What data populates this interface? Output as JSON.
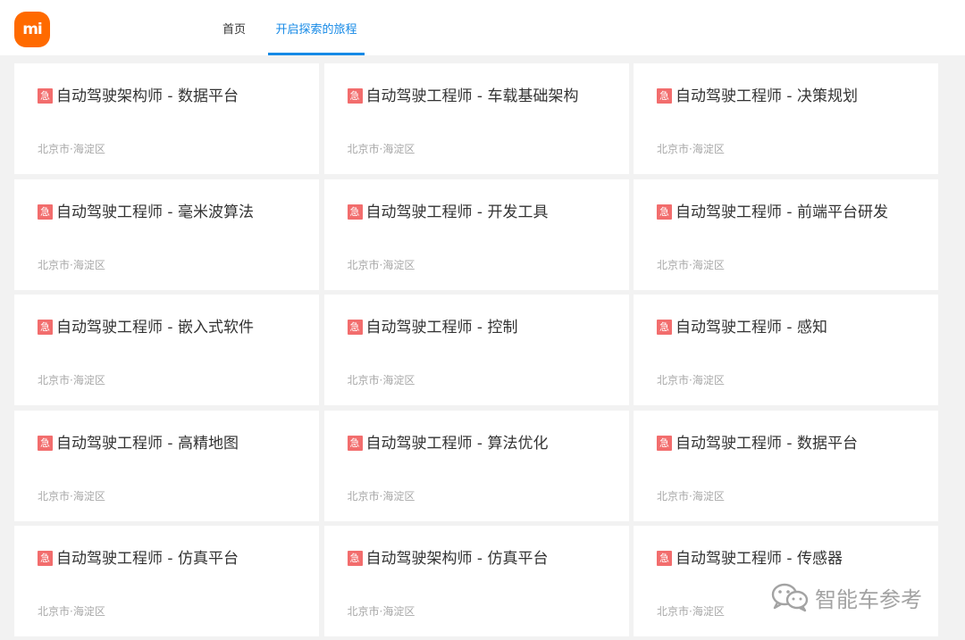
{
  "header": {
    "logo_text": "mi",
    "nav": [
      {
        "label": "首页"
      },
      {
        "label": "开启探索的旅程"
      }
    ]
  },
  "jobs": [
    {
      "badge": "急",
      "title": "自动驾驶架构师 - 数据平台",
      "location": "北京市·海淀区"
    },
    {
      "badge": "急",
      "title": "自动驾驶工程师 - 车载基础架构",
      "location": "北京市·海淀区"
    },
    {
      "badge": "急",
      "title": "自动驾驶工程师 - 决策规划",
      "location": "北京市·海淀区"
    },
    {
      "badge": "急",
      "title": "自动驾驶工程师 - 毫米波算法",
      "location": "北京市·海淀区"
    },
    {
      "badge": "急",
      "title": "自动驾驶工程师 - 开发工具",
      "location": "北京市·海淀区"
    },
    {
      "badge": "急",
      "title": "自动驾驶工程师 - 前端平台研发",
      "location": "北京市·海淀区"
    },
    {
      "badge": "急",
      "title": "自动驾驶工程师 - 嵌入式软件",
      "location": "北京市·海淀区"
    },
    {
      "badge": "急",
      "title": "自动驾驶工程师 - 控制",
      "location": "北京市·海淀区"
    },
    {
      "badge": "急",
      "title": "自动驾驶工程师 - 感知",
      "location": "北京市·海淀区"
    },
    {
      "badge": "急",
      "title": "自动驾驶工程师 - 高精地图",
      "location": "北京市·海淀区"
    },
    {
      "badge": "急",
      "title": "自动驾驶工程师 - 算法优化",
      "location": "北京市·海淀区"
    },
    {
      "badge": "急",
      "title": "自动驾驶工程师 - 数据平台",
      "location": "北京市·海淀区"
    },
    {
      "badge": "急",
      "title": "自动驾驶工程师 - 仿真平台",
      "location": "北京市·海淀区"
    },
    {
      "badge": "急",
      "title": "自动驾驶架构师 - 仿真平台",
      "location": "北京市·海淀区"
    },
    {
      "badge": "急",
      "title": "自动驾驶工程师 - 传感器",
      "location": "北京市·海淀区"
    }
  ],
  "watermark": {
    "icon": "wechat-icon",
    "text": "智能车参考"
  },
  "colors": {
    "brand": "#ff6a00",
    "accent": "#1589e6",
    "urgent": "#f26d6d",
    "background": "#f2f2f2"
  }
}
